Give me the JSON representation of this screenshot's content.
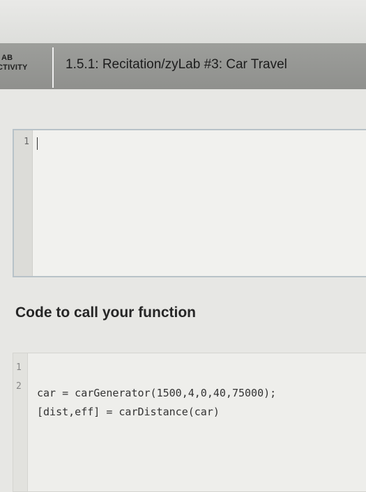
{
  "header": {
    "lab_line1": "AB",
    "lab_line2": "CTIVITY",
    "title": "1.5.1: Recitation/zyLab #3: Car Travel"
  },
  "editor": {
    "line_numbers": [
      "1"
    ],
    "content": ""
  },
  "call_section": {
    "title": "Code to call your function",
    "lines": [
      {
        "no": "1",
        "code": "car = carGenerator(1500,4,0,40,75000);"
      },
      {
        "no": "2",
        "code": "[dist,eff] = carDistance(car)"
      }
    ]
  }
}
